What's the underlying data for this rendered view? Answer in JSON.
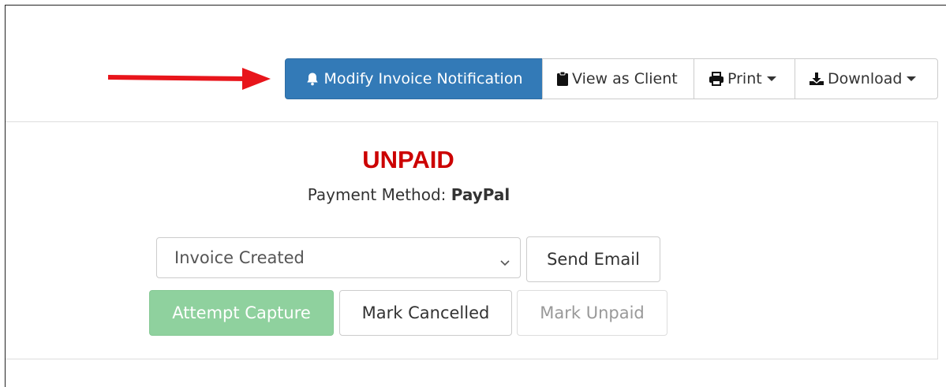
{
  "toolbar": {
    "modify_label": "Modify Invoice Notification",
    "view_client_label": "View as Client",
    "print_label": "Print",
    "download_label": "Download"
  },
  "invoice": {
    "status": "UNPAID",
    "payment_method_prefix": "Payment Method: ",
    "payment_method": "PayPal"
  },
  "email": {
    "selected_template": "Invoice Created",
    "send_label": "Send Email"
  },
  "actions": {
    "attempt_capture": "Attempt Capture",
    "mark_cancelled": "Mark Cancelled",
    "mark_unpaid": "Mark Unpaid"
  },
  "colors": {
    "primary": "#337ab7",
    "status_unpaid": "#cc0000",
    "success_light": "#8fd19e",
    "annotation_arrow": "#e8151b"
  },
  "icons": {
    "modify": "bell-icon",
    "view_client": "clipboard-icon",
    "print": "printer-icon",
    "download": "download-icon"
  }
}
